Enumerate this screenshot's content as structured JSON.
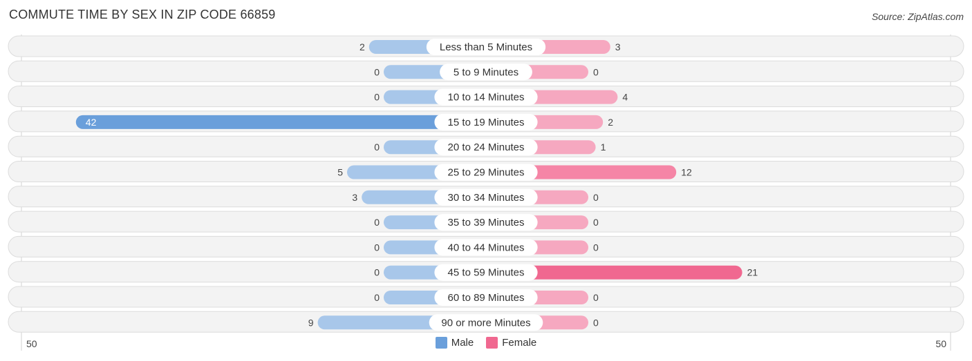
{
  "header": {
    "title": "COMMUTE TIME BY SEX IN ZIP CODE 66859",
    "source": "Source: ZipAtlas.com"
  },
  "colors": {
    "male": "#6a9fdb",
    "male_light": "#a8c7ea",
    "female": "#f06890",
    "female_light": "#f6a8c0"
  },
  "chart_data": {
    "type": "bar",
    "orientation": "horizontal-diverging",
    "title": "COMMUTE TIME BY SEX IN ZIP CODE 66859",
    "categories": [
      "Less than 5 Minutes",
      "5 to 9 Minutes",
      "10 to 14 Minutes",
      "15 to 19 Minutes",
      "20 to 24 Minutes",
      "25 to 29 Minutes",
      "30 to 34 Minutes",
      "35 to 39 Minutes",
      "40 to 44 Minutes",
      "45 to 59 Minutes",
      "60 to 89 Minutes",
      "90 or more Minutes"
    ],
    "series": [
      {
        "name": "Male",
        "values": [
          2,
          0,
          0,
          42,
          0,
          5,
          3,
          0,
          0,
          0,
          0,
          9
        ]
      },
      {
        "name": "Female",
        "values": [
          3,
          0,
          4,
          2,
          1,
          12,
          0,
          0,
          0,
          21,
          0,
          0
        ]
      }
    ],
    "axis": {
      "left_label": "50",
      "right_label": "50",
      "max": 50
    },
    "legend": {
      "position": "bottom-center",
      "entries": [
        "Male",
        "Female"
      ]
    }
  }
}
